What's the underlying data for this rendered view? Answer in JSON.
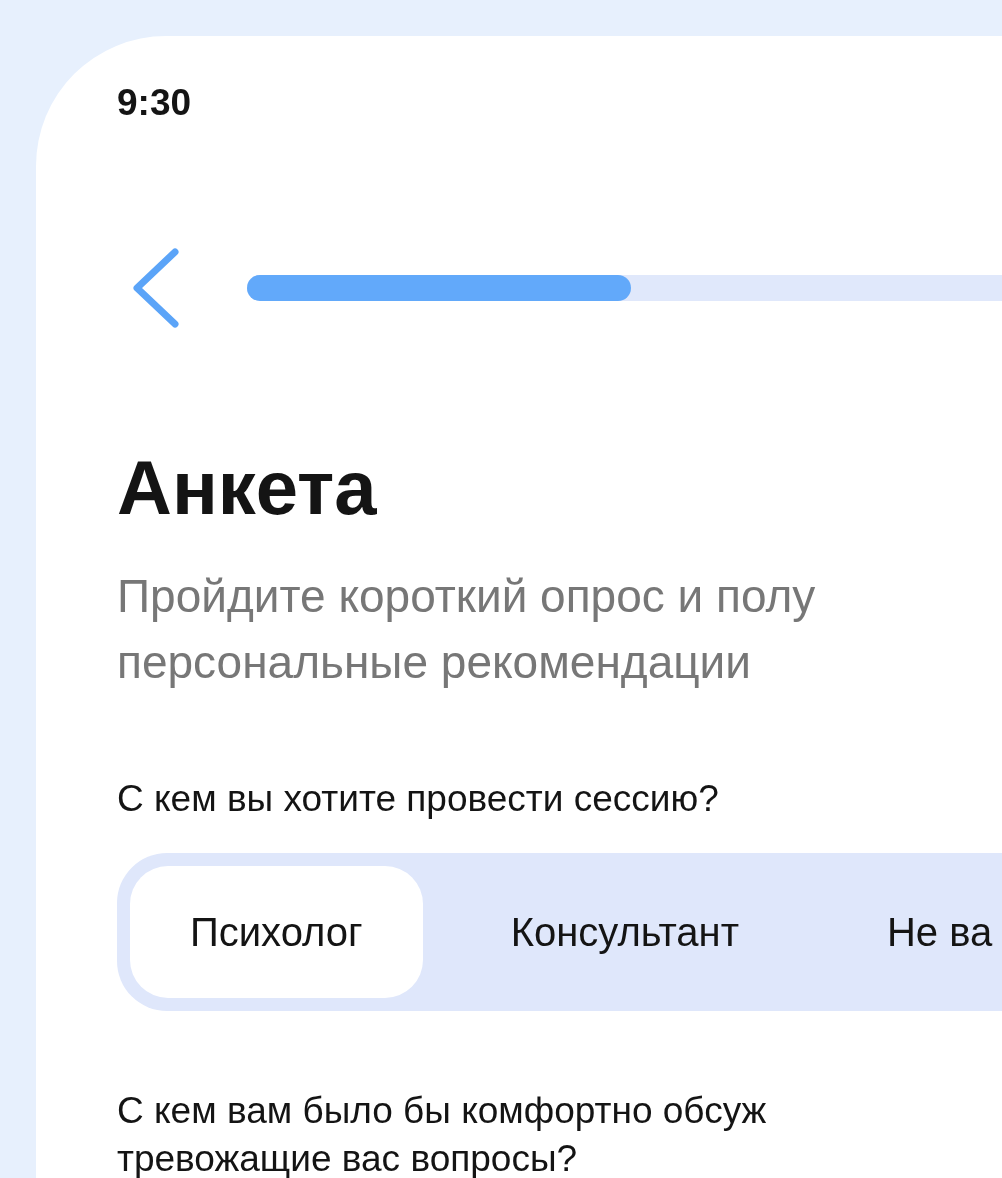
{
  "status_bar": {
    "time": "9:30"
  },
  "progress": {
    "level": 0.4
  },
  "title": "Анкета",
  "subtitle_lines": [
    "Пройдите короткий опрос и полу",
    "персональные рекомендации"
  ],
  "questions": [
    {
      "kind": "segmented",
      "text_lines": [
        "С кем вы хотите провести сессию?"
      ],
      "options": [
        {
          "label": "Психолог",
          "selected": true
        },
        {
          "label": "Консультант",
          "selected": false
        },
        {
          "label": "Не ва",
          "selected": false
        }
      ]
    },
    {
      "kind": "text",
      "text_lines": [
        "С кем вам было бы комфортно обсуж",
        "тревожащие вас вопросы?"
      ]
    }
  ]
}
